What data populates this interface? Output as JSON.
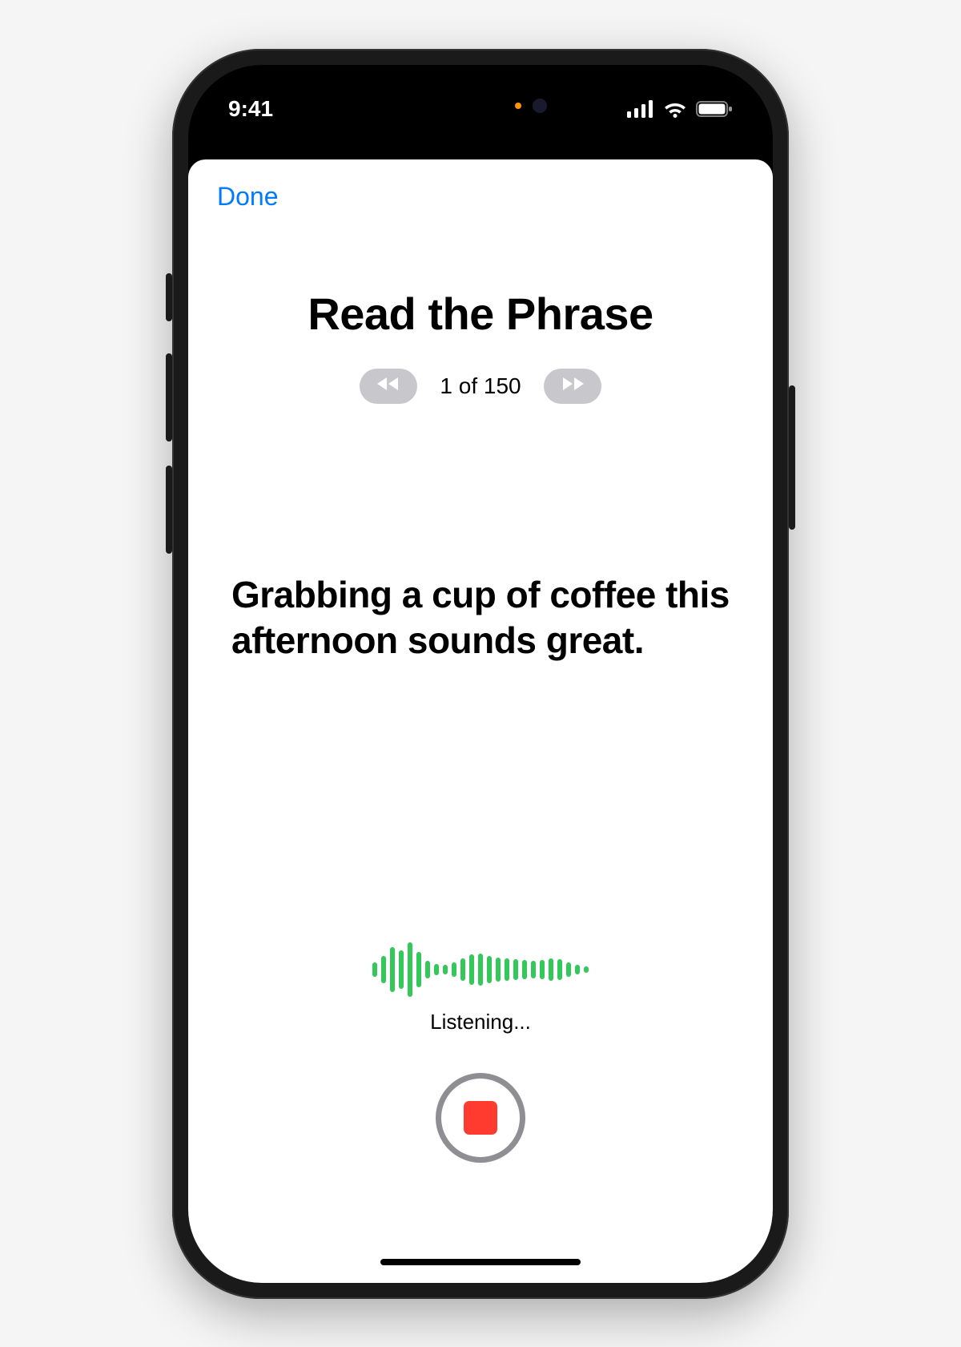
{
  "status": {
    "time": "9:41",
    "icons": {
      "cellular": "cellular-icon",
      "wifi": "wifi-icon",
      "battery": "battery-icon"
    }
  },
  "nav": {
    "done_label": "Done"
  },
  "header": {
    "title": "Read the Phrase",
    "pager_label": "1 of 150"
  },
  "phrase": {
    "text": "Grabbing a cup of coffee this afternoon sounds great."
  },
  "recording": {
    "status_text": "Listening...",
    "waveform_heights": [
      18,
      34,
      56,
      48,
      68,
      44,
      22,
      14,
      12,
      18,
      28,
      38,
      40,
      34,
      30,
      28,
      26,
      24,
      22,
      24,
      28,
      26,
      18,
      12,
      8
    ]
  },
  "colors": {
    "accent": "#007aff",
    "waveform": "#34c759",
    "stop": "#ff3b30",
    "disabled_pill": "#c7c7cc"
  }
}
